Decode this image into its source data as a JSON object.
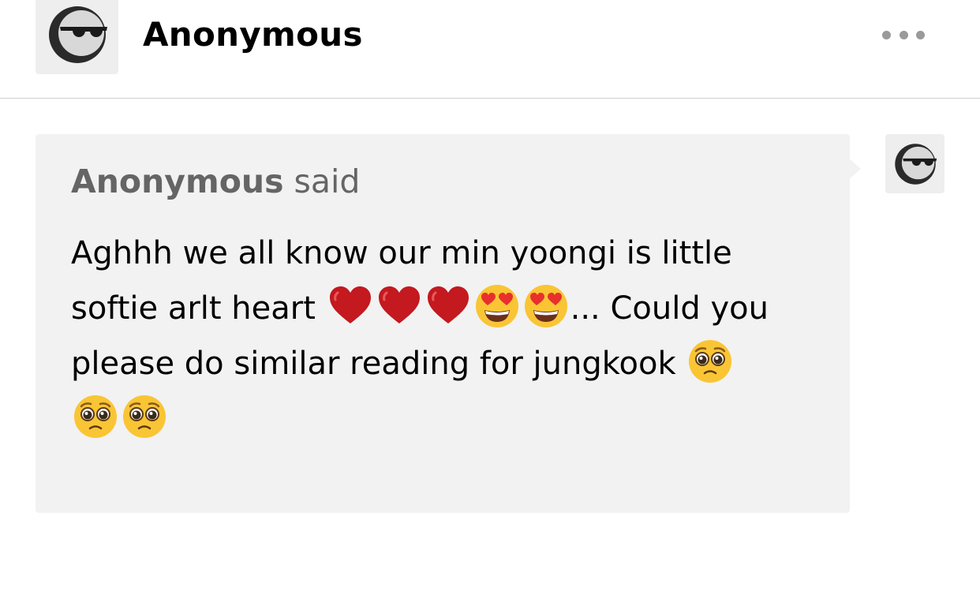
{
  "header": {
    "avatar_icon": "sunglasses-face-icon",
    "name": "Anonymous",
    "more_icon": "ellipsis-icon"
  },
  "ask": {
    "asker": "Anonymous",
    "said": "said",
    "avatar_icon": "sunglasses-face-icon",
    "line1": "Aghhh we all know our min yoongi is little",
    "line2_text": "softie arlt heart ",
    "line2_emojis": [
      "red-heart",
      "red-heart",
      "red-heart",
      "heart-eyes-face",
      "heart-eyes-face"
    ],
    "line2_tail": "... Could you",
    "line3_text": "please do similar reading for jungkook ",
    "line3_emojis": [
      "pleading-face"
    ],
    "line4_emojis": [
      "pleading-face",
      "pleading-face"
    ]
  },
  "colors": {
    "bubble": "#f2f2f2",
    "avatar_bg": "#eeeeee",
    "said_text": "#656565",
    "divider": "#cfcfcf"
  }
}
